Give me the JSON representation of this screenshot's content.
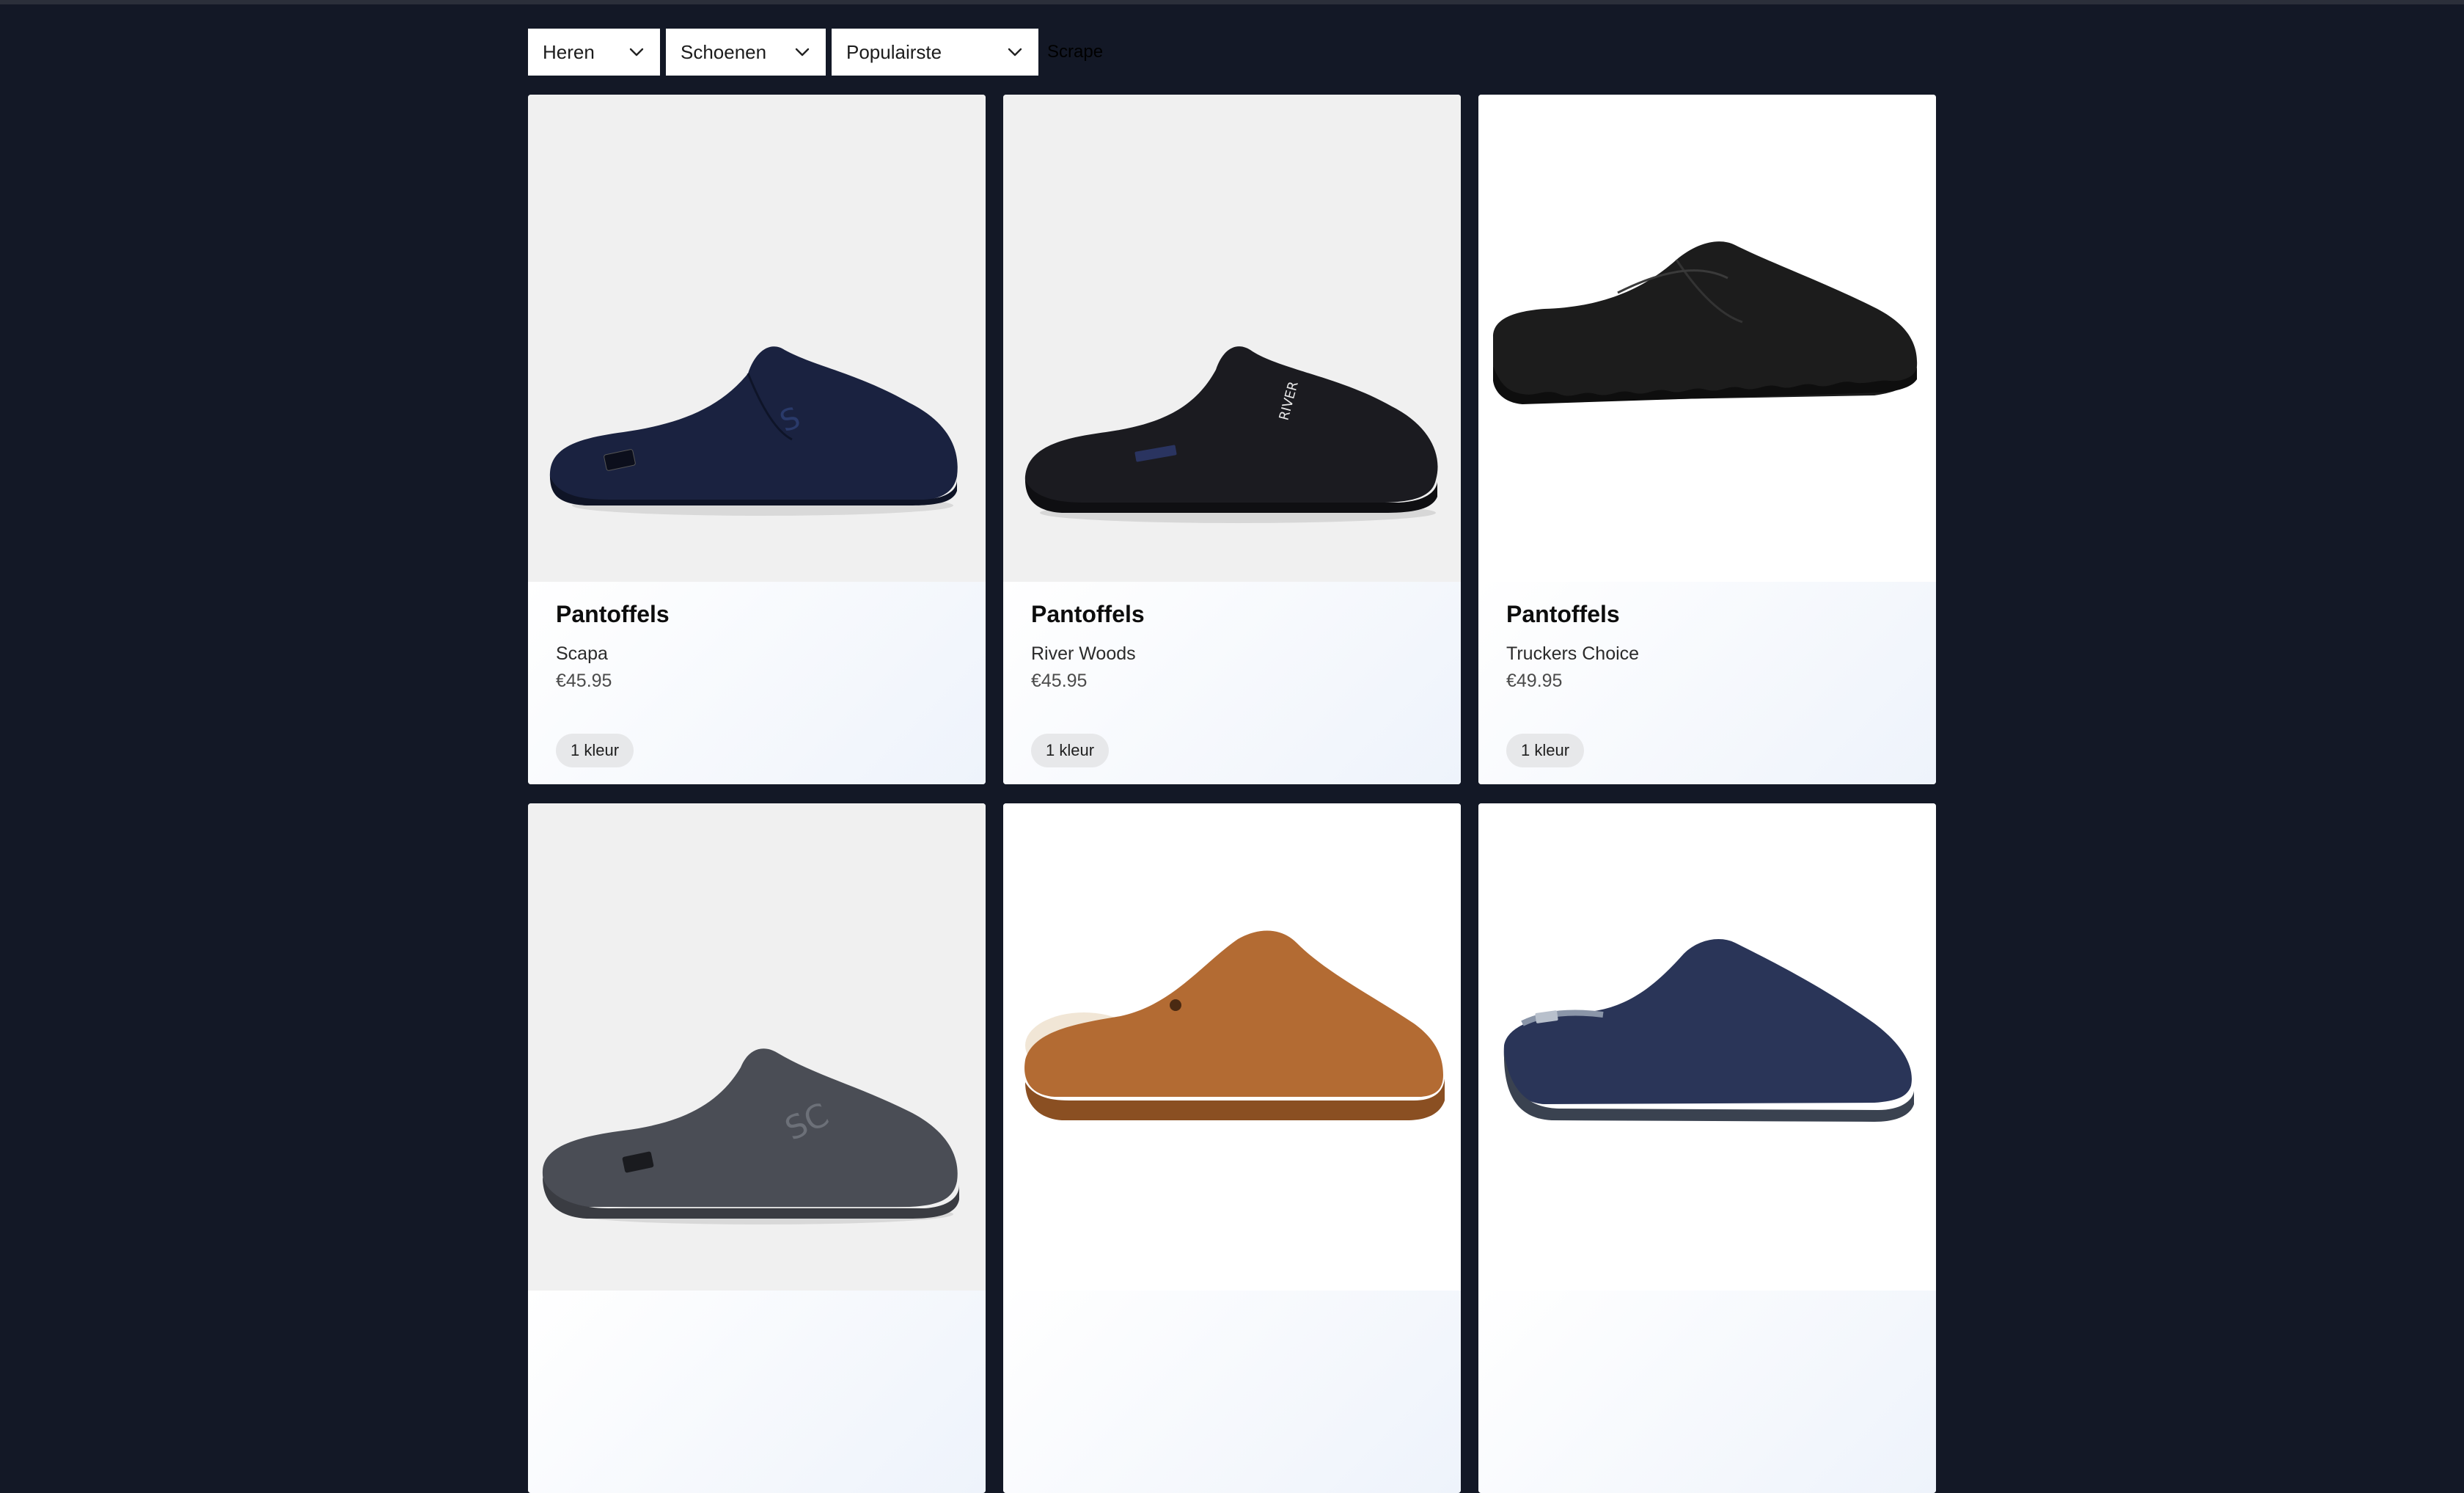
{
  "filters": {
    "gender": "Heren",
    "category": "Schoenen",
    "sort": "Populairste"
  },
  "scrape_label": "Scrape",
  "products": [
    {
      "type": "Pantoffels",
      "brand": "Scapa",
      "price": "€45.95",
      "colors": "1 kleur",
      "image": "navy-felt-slipper"
    },
    {
      "type": "Pantoffels",
      "brand": "River Woods",
      "price": "€45.95",
      "colors": "1 kleur",
      "image": "black-felt-slipper"
    },
    {
      "type": "Pantoffels",
      "brand": "Truckers Choice",
      "price": "€49.95",
      "colors": "1 kleur",
      "image": "black-leather-clog"
    },
    {
      "type": "",
      "brand": "",
      "price": "",
      "colors": "",
      "image": "grey-scapa-slipper"
    },
    {
      "type": "",
      "brand": "",
      "price": "",
      "colors": "",
      "image": "brown-suede-slipper"
    },
    {
      "type": "",
      "brand": "",
      "price": "",
      "colors": "",
      "image": "blue-knit-slipper"
    }
  ],
  "colors": {
    "background": "#131826",
    "card_info": "#f4f7fc",
    "badge": "#e7e8ea"
  }
}
